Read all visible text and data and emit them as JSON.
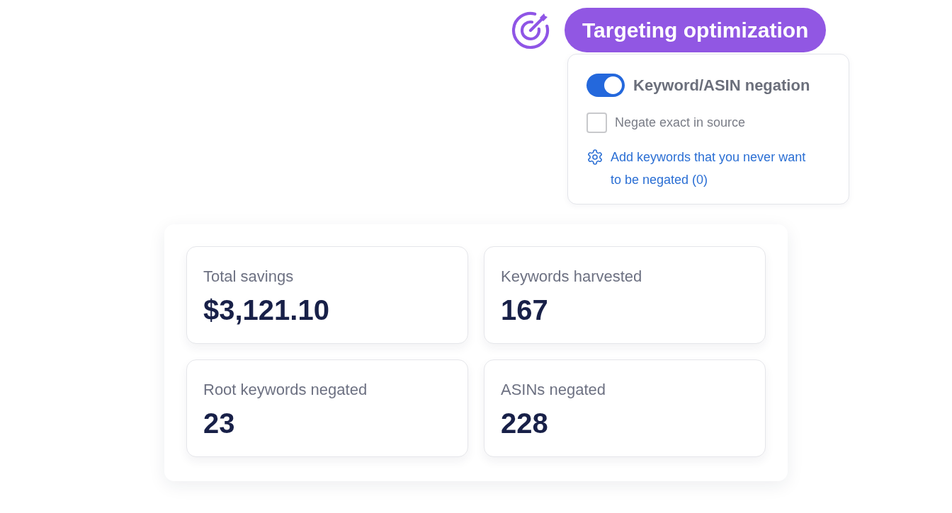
{
  "header": {
    "title": "Targeting optimization"
  },
  "popover": {
    "toggle": {
      "label": "Keyword/ASIN negation",
      "on": true
    },
    "checkbox": {
      "label": "Negate exact in source",
      "checked": false
    },
    "link": {
      "label": "Add keywords that you never want to be negated (0)"
    }
  },
  "stats": [
    {
      "label": "Total savings",
      "value": "$3,121.10"
    },
    {
      "label": "Keywords harvested",
      "value": "167"
    },
    {
      "label": "Root keywords negated",
      "value": "23"
    },
    {
      "label": "ASINs negated",
      "value": "228"
    }
  ]
}
